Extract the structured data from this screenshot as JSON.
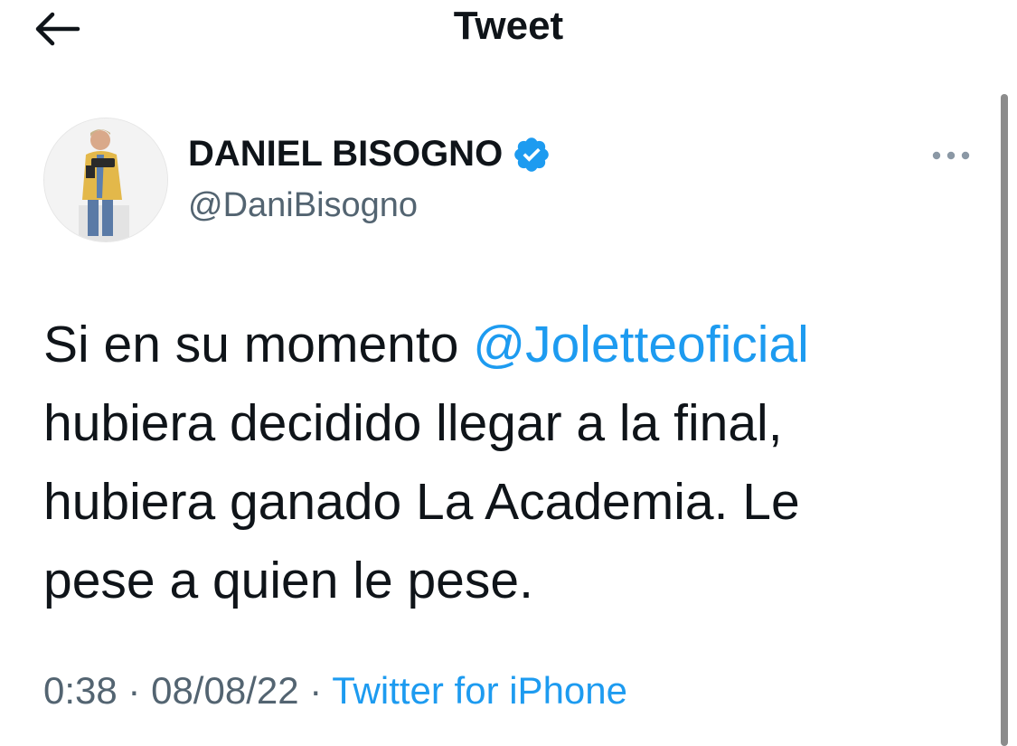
{
  "header": {
    "title": "Tweet",
    "back_icon": "back-arrow-icon"
  },
  "tweet": {
    "author": {
      "name": "DANIEL BISOGNO",
      "handle": "@DaniBisogno",
      "verified": true,
      "verified_icon": "verified-badge-icon"
    },
    "more_icon": "more-options-icon",
    "text_before": "Si en su momento ",
    "mention": "@Joletteoficial",
    "text_after": "\nhubiera decidido llegar a la final,\nhubiera ganado La Academia. Le\npese a quien le pese.",
    "time": "0:38",
    "separator": "·",
    "date": "08/08/22",
    "source": "Twitter for iPhone"
  },
  "colors": {
    "link": "#1d9bf0",
    "text": "#0f1419",
    "secondary": "#536471",
    "verified": "#1d9bf0"
  }
}
